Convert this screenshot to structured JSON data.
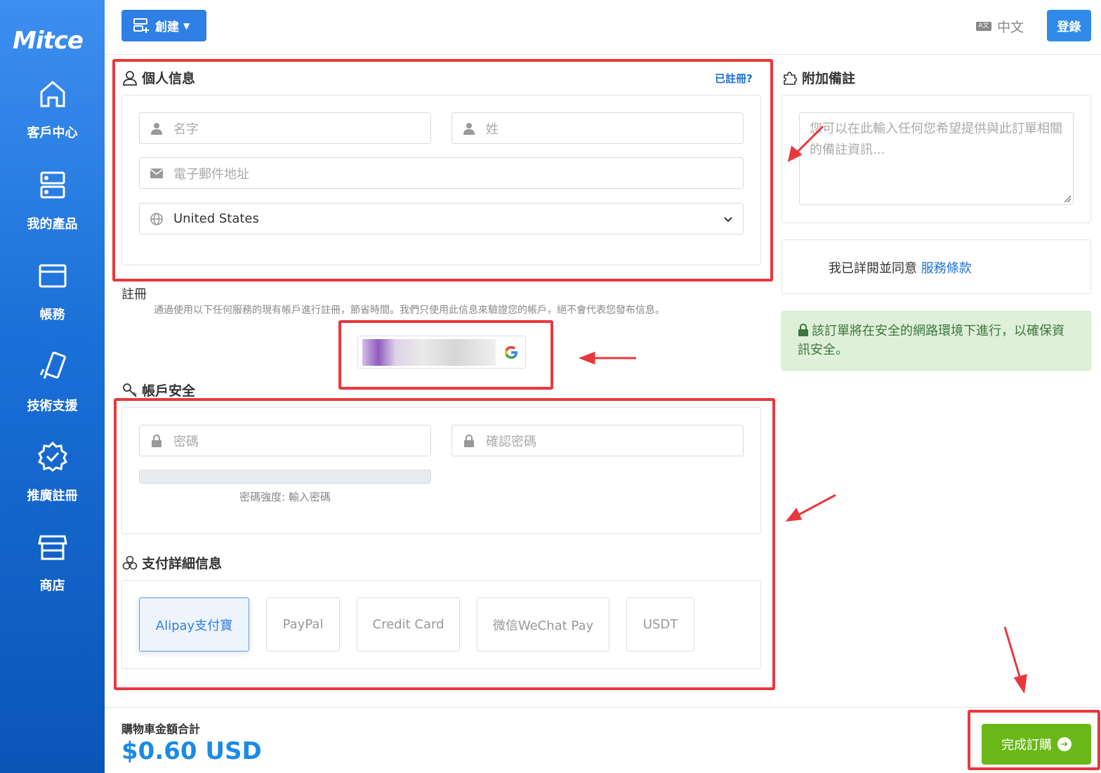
{
  "sidebar": {
    "logo": "Mitce",
    "items": [
      {
        "label": "客戶中心",
        "icon": "home-icon"
      },
      {
        "label": "我的產品",
        "icon": "server-icon"
      },
      {
        "label": "帳務",
        "icon": "credit-card-icon"
      },
      {
        "label": "技術支援",
        "icon": "support-icon"
      },
      {
        "label": "推廣註冊",
        "icon": "badge-check-icon"
      },
      {
        "label": "商店",
        "icon": "store-icon"
      }
    ]
  },
  "topbar": {
    "create_label": "創建",
    "language": "中文",
    "login_label": "登錄"
  },
  "personal": {
    "title": "個人信息",
    "registered_link": "已註冊?",
    "first_name_placeholder": "名字",
    "last_name_placeholder": "姓",
    "email_placeholder": "電子郵件地址",
    "country_value": "United States"
  },
  "register": {
    "title": "註冊",
    "description": "通過使用以下任何服務的現有帳戶進行註冊，節省時間。我們只使用此信息來驗證您的帳戶，絕不會代表您發布信息。"
  },
  "security": {
    "title": "帳戶安全",
    "password_placeholder": "密碼",
    "confirm_placeholder": "確認密碼",
    "strength_text": "密碼強度: 輸入密碼"
  },
  "payment": {
    "title": "支付詳細信息",
    "methods": [
      "Alipay支付寶",
      "PayPal",
      "Credit Card",
      "微信WeChat Pay",
      "USDT"
    ],
    "selected": "Alipay支付寶"
  },
  "notes": {
    "title": "附加備註",
    "placeholder": "您可以在此輸入任何您希望提供與此訂單相關的備註資訊..."
  },
  "terms": {
    "prefix": "我已詳閱並同意",
    "link": "服務條款"
  },
  "secure_notice": "該訂單將在安全的網路環境下進行，以確保資訊安全。",
  "footer": {
    "total_label": "購物車金額合計",
    "total_value": "$0.60 USD",
    "complete_label": "完成訂購"
  },
  "colors": {
    "sidebar_top": "#3d8ef0",
    "sidebar_bottom": "#0a55b8",
    "primary": "#2f7fe6",
    "success": "#6ab818",
    "annotation_red": "#e8383d"
  }
}
